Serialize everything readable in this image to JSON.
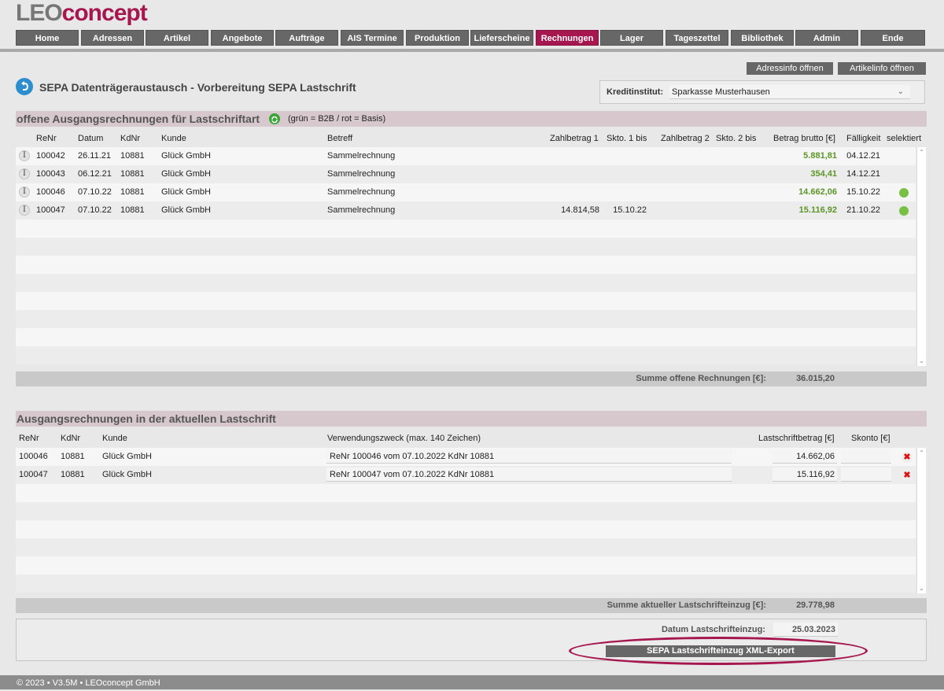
{
  "logo": {
    "part1": "LEO",
    "part2": "concept"
  },
  "nav": [
    {
      "label": "Home"
    },
    {
      "label": "Adressen"
    },
    {
      "label": "Artikel"
    },
    {
      "label": "Angebote"
    },
    {
      "label": "Aufträge"
    },
    {
      "label": "AIS Termine"
    },
    {
      "label": "Produktion"
    },
    {
      "label": "Lieferscheine"
    },
    {
      "label": "Rechnungen",
      "active": true
    },
    {
      "label": "Lager"
    },
    {
      "label": "Tageszettel"
    },
    {
      "label": "Bibliothek"
    },
    {
      "label": "Admin"
    },
    {
      "label": "Ende"
    }
  ],
  "toolbar": {
    "adressinfo": "Adressinfo öffnen",
    "artikelinfo": "Artikelinfo öffnen"
  },
  "page": {
    "title": "SEPA Datenträgeraustausch - Vorbereitung SEPA Lastschrift"
  },
  "kreditinstitut": {
    "label": "Kreditinstitut:",
    "value": "Sparkasse Musterhausen"
  },
  "offene": {
    "heading": "offene Ausgangsrechnungen für Lastschriftart",
    "legend": "(grün = B2B / rot = Basis)",
    "columns": {
      "renr": "ReNr",
      "datum": "Datum",
      "kdnr": "KdNr",
      "kunde": "Kunde",
      "betreff": "Betreff",
      "zahl1": "Zahlbetrag 1",
      "skto1": "Skto. 1 bis",
      "zahl2": "Zahlbetrag 2",
      "skto2": "Skto. 2 bis",
      "brutto": "Betrag brutto [€]",
      "faellig": "Fälligkeit",
      "selektiert": "selektiert"
    },
    "rows": [
      {
        "renr": "100042",
        "datum": "26.11.21",
        "kdnr": "10881",
        "kunde": "Glück GmbH",
        "betreff": "Sammelrechnung",
        "zahl1": "",
        "skto1": "",
        "zahl2": "",
        "skto2": "",
        "brutto": "5.881,81",
        "faellig": "04.12.21",
        "selected": false
      },
      {
        "renr": "100043",
        "datum": "06.12.21",
        "kdnr": "10881",
        "kunde": "Glück GmbH",
        "betreff": "Sammelrechnung",
        "zahl1": "",
        "skto1": "",
        "zahl2": "",
        "skto2": "",
        "brutto": "354,41",
        "faellig": "14.12.21",
        "selected": false
      },
      {
        "renr": "100046",
        "datum": "07.10.22",
        "kdnr": "10881",
        "kunde": "Glück GmbH",
        "betreff": "Sammelrechnung",
        "zahl1": "",
        "skto1": "",
        "zahl2": "",
        "skto2": "",
        "brutto": "14.662,06",
        "faellig": "15.10.22",
        "selected": true
      },
      {
        "renr": "100047",
        "datum": "07.10.22",
        "kdnr": "10881",
        "kunde": "Glück GmbH",
        "betreff": "Sammelrechnung",
        "zahl1": "14.814,58",
        "skto1": "15.10.22",
        "zahl2": "",
        "skto2": "",
        "brutto": "15.116,92",
        "faellig": "21.10.22",
        "selected": true
      }
    ],
    "sum_label": "Summe offene Rechnungen [€]:",
    "sum_value": "36.015,20"
  },
  "aktuell": {
    "heading": "Ausgangsrechnungen in der aktuellen Lastschrift",
    "columns": {
      "renr": "ReNr",
      "kdnr": "KdNr",
      "kunde": "Kunde",
      "zweck": "Verwendungszweck (max. 140 Zeichen)",
      "betrag": "Lastschriftbetrag [€]",
      "skonto": "Skonto [€]"
    },
    "rows": [
      {
        "renr": "100046",
        "kdnr": "10881",
        "kunde": "Glück GmbH",
        "zweck": "ReNr 100046 vom 07.10.2022 KdNr 10881",
        "betrag": "14.662,06",
        "skonto": ""
      },
      {
        "renr": "100047",
        "kdnr": "10881",
        "kunde": "Glück GmbH",
        "zweck": "ReNr 100047 vom 07.10.2022 KdNr 10881",
        "betrag": "15.116,92",
        "skonto": ""
      }
    ],
    "sum_label": "Summe aktueller Lastschrifteinzug [€]:",
    "sum_value": "29.778,98"
  },
  "einzug": {
    "datum_label": "Datum Lastschrifteinzug:",
    "datum_value": "25.03.2023",
    "export_label": "SEPA Lastschrifteinzug XML-Export"
  },
  "footer": {
    "text": "© 2023 • V3.5M • LEOconcept GmbH"
  },
  "colors": {
    "accent": "#a5174e",
    "green": "#77c043",
    "amount_green": "#5c9627",
    "nav_bg": "#676767"
  }
}
